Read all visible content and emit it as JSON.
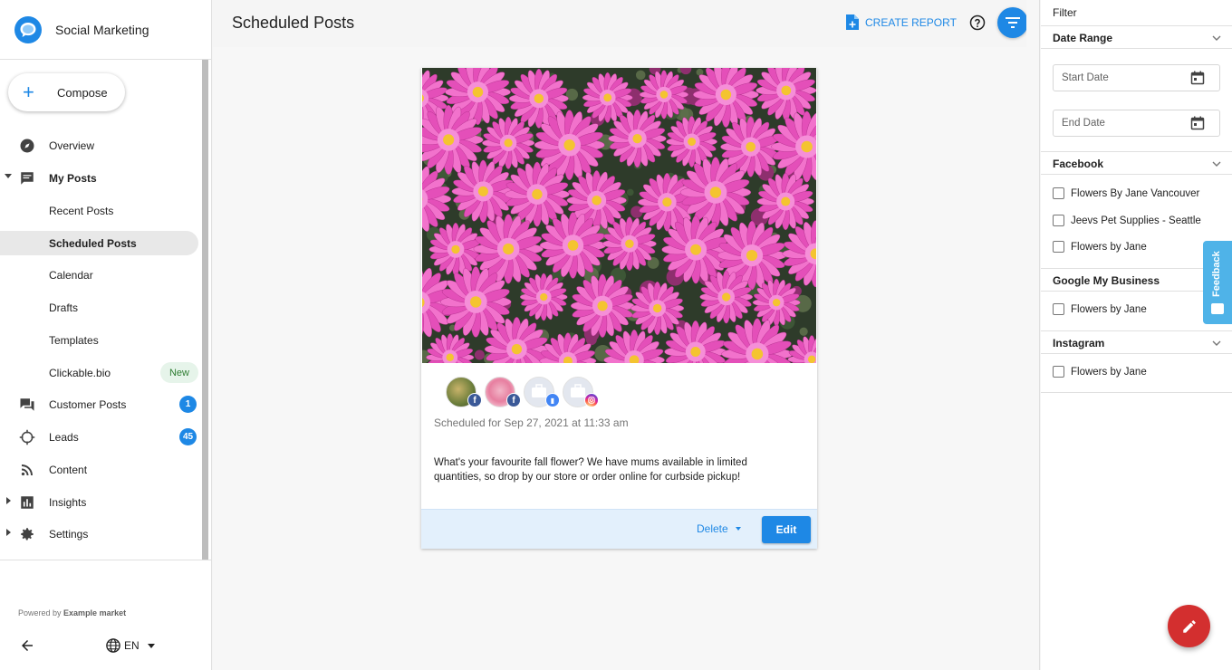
{
  "app": {
    "title": "Social Marketing"
  },
  "sidebar": {
    "compose_label": "Compose",
    "items": [
      {
        "label": "Overview",
        "icon": "compass-icon"
      },
      {
        "label": "My Posts",
        "icon": "chat-icon"
      },
      {
        "label": "Recent Posts"
      },
      {
        "label": "Scheduled Posts"
      },
      {
        "label": "Calendar"
      },
      {
        "label": "Drafts"
      },
      {
        "label": "Templates"
      },
      {
        "label": "Clickable.bio",
        "pill": "New"
      },
      {
        "label": "Customer Posts",
        "icon": "forum-icon",
        "badge": "1"
      },
      {
        "label": "Leads",
        "icon": "crosshair-icon",
        "badge": "45"
      },
      {
        "label": "Content",
        "icon": "rss-icon"
      },
      {
        "label": "Insights",
        "icon": "bar-chart-icon"
      },
      {
        "label": "Settings",
        "icon": "gear-icon"
      }
    ],
    "footer": {
      "powered_by": "Powered by",
      "powered_brand": "Example market",
      "language": "EN"
    }
  },
  "header": {
    "title": "Scheduled Posts",
    "create_report": "CREATE REPORT"
  },
  "post": {
    "scheduled": "Scheduled for Sep 27, 2021 at 11:33 am",
    "text": "What's your favourite fall flower? We have mums available in limited quantities, so drop by our store or order online for curbside pickup!",
    "delete_label": "Delete",
    "edit_label": "Edit",
    "accounts": [
      {
        "network": "facebook"
      },
      {
        "network": "facebook"
      },
      {
        "network": "google-my-business"
      },
      {
        "network": "instagram"
      }
    ]
  },
  "filter": {
    "title": "Filter",
    "date_range": {
      "label": "Date Range",
      "start_placeholder": "Start Date",
      "end_placeholder": "End Date"
    },
    "facebook": {
      "label": "Facebook",
      "options": [
        "Flowers By Jane Vancouver",
        "Jeevs Pet Supplies - Seattle",
        "Flowers by Jane"
      ]
    },
    "google_my_business": {
      "label": "Google My Business",
      "options": [
        "Flowers by Jane"
      ]
    },
    "instagram": {
      "label": "Instagram",
      "options": [
        "Flowers by Jane"
      ]
    }
  },
  "feedback": {
    "label": "Feedback"
  },
  "colors": {
    "accent": "#1e88e5",
    "fab": "#d32f2f",
    "facebook": "#3b5998",
    "gmb": "#4285f4",
    "instagram": "#c13584",
    "feedback": "#4fb3e8"
  }
}
